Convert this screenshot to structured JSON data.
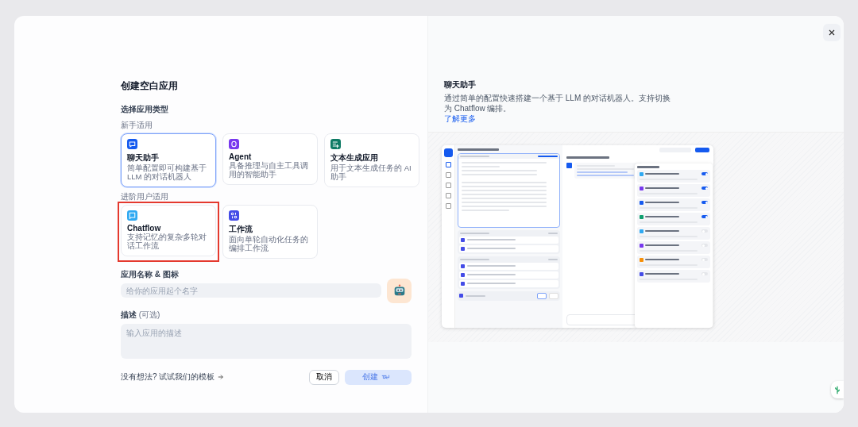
{
  "dialog": {
    "title": "创建空白应用"
  },
  "type_section": {
    "label": "选择应用类型",
    "groups": [
      {
        "label": "新手适用",
        "types": [
          {
            "kind": "chat",
            "name": "聊天助手",
            "description": "简单配置即可构建基于 LLM 的对话机器人",
            "color": "#155aef",
            "selected": true,
            "highlighted": false
          },
          {
            "kind": "agent",
            "name": "Agent",
            "description": "具备推理与自主工具调用的智能助手",
            "color": "#7839ee",
            "selected": false,
            "highlighted": false
          },
          {
            "kind": "text",
            "name": "文本生成应用",
            "description": "用于文本生成任务的 AI 助手",
            "color": "#0e7a64",
            "selected": false,
            "highlighted": false
          }
        ]
      },
      {
        "label": "进阶用户适用",
        "types": [
          {
            "kind": "chatflow",
            "name": "Chatflow",
            "description": "支持记忆的复杂多轮对话工作流",
            "color": "#2fa9f2",
            "selected": false,
            "highlighted": true
          },
          {
            "kind": "workflow",
            "name": "工作流",
            "description": "面向单轮自动化任务的编排工作流",
            "color": "#444ce7",
            "selected": false,
            "highlighted": false
          }
        ]
      }
    ]
  },
  "name_field": {
    "label": "应用名称 & 图标",
    "placeholder": "给你的应用起个名字"
  },
  "description_field": {
    "label": "描述",
    "optional": "(可选)",
    "placeholder": "输入应用的描述"
  },
  "footer": {
    "template_link": "没有想法? 试试我们的模板",
    "cancel": "取消",
    "create": "创建",
    "create_disabled": true
  },
  "preview": {
    "title": "聊天助手",
    "description": "通过简单的配置快速搭建一个基于 LLM 的对话机器人。支持切换为 Chatflow 编排。",
    "link": "了解更多"
  }
}
